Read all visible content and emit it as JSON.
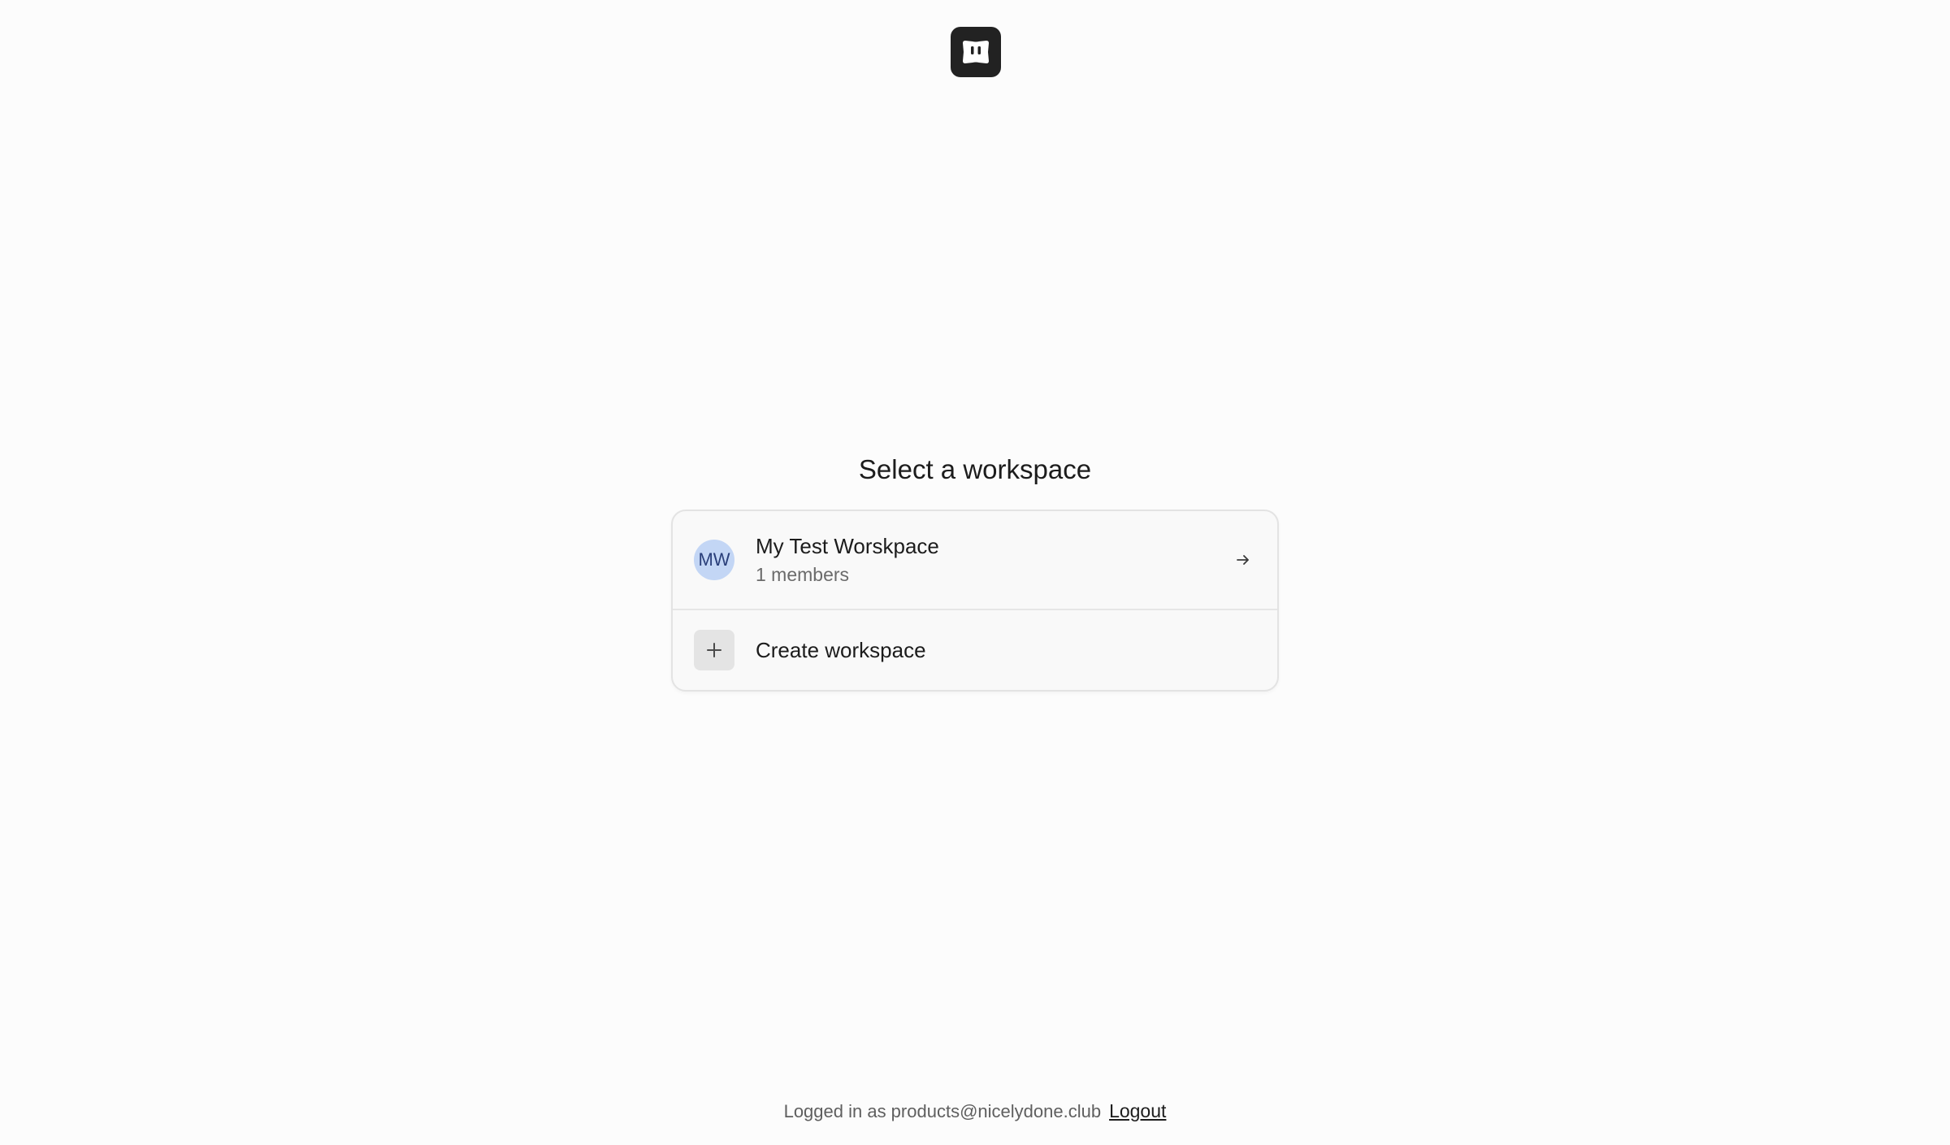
{
  "logo": {
    "icon": "app-logo-icon",
    "color": "#222222"
  },
  "title": "Select a workspace",
  "workspaces": [
    {
      "initials": "MW",
      "name": "My Test Worskpace",
      "members": "1 members",
      "avatar_color": "#c3d6f5",
      "action_icon": "arrow-right-icon"
    }
  ],
  "create": {
    "label": "Create workspace",
    "icon": "plus-icon"
  },
  "footer": {
    "logged_in_text": "Logged in as products@nicelydone.club",
    "logout_label": "Logout"
  }
}
